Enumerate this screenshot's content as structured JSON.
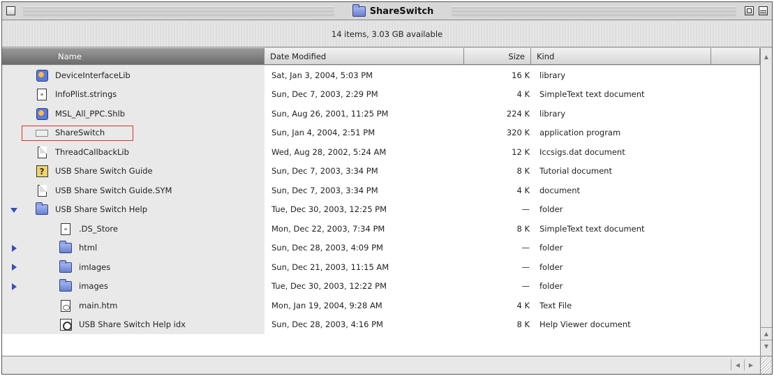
{
  "window": {
    "title": "ShareSwitch",
    "status": "14 items, 3.03 GB available"
  },
  "columns": {
    "name": "Name",
    "date": "Date Modified",
    "size": "Size",
    "kind": "Kind"
  },
  "rows": [
    {
      "name": "DeviceInterfaceLib",
      "date": "Sat, Jan 3, 2004, 5:03 PM",
      "size": "16 K",
      "kind": "library",
      "icon": "library-icon",
      "indent": 0,
      "disclosure": "none",
      "selected": false
    },
    {
      "name": "InfoPlist.strings",
      "date": "Sun, Dec 7, 2003, 2:29 PM",
      "size": "4 K",
      "kind": "SimpleText text document",
      "icon": "text-document-icon",
      "indent": 0,
      "disclosure": "none",
      "selected": false
    },
    {
      "name": "MSL_All_PPC.Shlb",
      "date": "Sun, Aug 26, 2001, 11:25 PM",
      "size": "224 K",
      "kind": "library",
      "icon": "library-icon",
      "indent": 0,
      "disclosure": "none",
      "selected": false
    },
    {
      "name": "ShareSwitch",
      "date": "Sun, Jan 4, 2004, 2:51 PM",
      "size": "320 K",
      "kind": "application program",
      "icon": "application-icon",
      "indent": 0,
      "disclosure": "none",
      "selected": true
    },
    {
      "name": "ThreadCallbackLib",
      "date": "Wed, Aug 28, 2002, 5:24 AM",
      "size": "12 K",
      "kind": "Iccsigs.dat document",
      "icon": "document-icon",
      "indent": 0,
      "disclosure": "none",
      "selected": false
    },
    {
      "name": "USB Share Switch Guide",
      "date": "Sun, Dec 7, 2003, 3:34 PM",
      "size": "8 K",
      "kind": "Tutorial document",
      "icon": "guide-icon",
      "indent": 0,
      "disclosure": "none",
      "selected": false
    },
    {
      "name": "USB Share Switch Guide.SYM",
      "date": "Sun, Dec 7, 2003, 3:34 PM",
      "size": "4 K",
      "kind": "document",
      "icon": "document-icon",
      "indent": 0,
      "disclosure": "none",
      "selected": false
    },
    {
      "name": "USB Share Switch Help",
      "date": "Tue, Dec 30, 2003, 12:25 PM",
      "size": "—",
      "kind": "folder",
      "icon": "folder-icon",
      "indent": 0,
      "disclosure": "expanded",
      "selected": false
    },
    {
      "name": ".DS_Store",
      "date": "Mon, Dec 22, 2003, 7:34 PM",
      "size": "8 K",
      "kind": "SimpleText text document",
      "icon": "text-document-icon",
      "indent": 1,
      "disclosure": "none",
      "selected": false
    },
    {
      "name": "html",
      "date": "Sun, Dec 28, 2003, 4:09 PM",
      "size": "—",
      "kind": "folder",
      "icon": "folder-icon",
      "indent": 1,
      "disclosure": "collapsed",
      "selected": false
    },
    {
      "name": "imIages",
      "date": "Sun, Dec 21, 2003, 11:15 AM",
      "size": "—",
      "kind": "folder",
      "icon": "folder-icon",
      "indent": 1,
      "disclosure": "collapsed",
      "selected": false
    },
    {
      "name": "images",
      "date": "Tue, Dec 30, 2003, 12:22 PM",
      "size": "—",
      "kind": "folder",
      "icon": "folder-icon",
      "indent": 1,
      "disclosure": "collapsed",
      "selected": false
    },
    {
      "name": "main.htm",
      "date": "Mon, Jan 19, 2004, 9:28 AM",
      "size": "4 K",
      "kind": "Text File",
      "icon": "html-file-icon",
      "indent": 1,
      "disclosure": "none",
      "selected": false
    },
    {
      "name": "USB Share Switch Help idx",
      "date": "Sun, Dec 28, 2003, 4:16 PM",
      "size": "8 K",
      "kind": "Help Viewer document",
      "icon": "help-index-icon",
      "indent": 1,
      "disclosure": "none",
      "selected": false
    }
  ]
}
